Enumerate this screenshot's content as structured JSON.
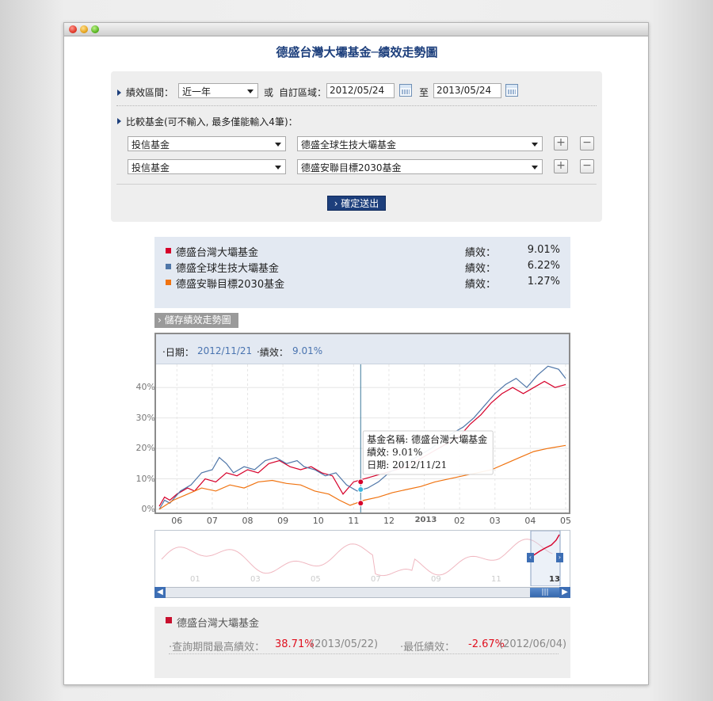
{
  "page_title": "德盛台灣大壩基金─績效走勢圖",
  "query": {
    "period_label": "績效區間：",
    "period_select": "近一年",
    "or_label": "或",
    "custom_label": "自訂區域：",
    "start_date": "2012/05/24",
    "to_label": "至",
    "end_date": "2013/05/24",
    "compare_label": "比較基金(可不輸入, 最多僅能輸入4筆)：",
    "compare_rows": [
      {
        "category": "投信基金",
        "fund": "德盛全球生技大壩基金"
      },
      {
        "category": "投信基金",
        "fund": "德盛安聯目標2030基金"
      }
    ],
    "plus": "+",
    "minus": "−",
    "submit": "› 確定送出"
  },
  "legend": [
    {
      "name": "德盛台灣大壩基金",
      "perf_label": "績效：",
      "perf": "9.01%",
      "color": "#d6002a"
    },
    {
      "name": "德盛全球生技大壩基金",
      "perf_label": "績效：",
      "perf": "6.22%",
      "color": "#4f76a8"
    },
    {
      "name": "德盛安聯目標2030基金",
      "perf_label": "績效：",
      "perf": "1.27%",
      "color": "#f07310"
    }
  ],
  "save_button": "› 儲存績效走勢圖",
  "chart_header": {
    "date_label": "‧日期：",
    "date_value": "2012/11/21",
    "perf_label": "‧績效：",
    "perf_value": "9.01%"
  },
  "tooltip": {
    "name_line": "基金名稱: 德盛台灣大壩基金",
    "perf_line": "績效: 9.01%",
    "date_line": "日期: 2012/11/21"
  },
  "chart_data": {
    "type": "line",
    "y_ticks": [
      "40%",
      "30%",
      "20%",
      "10%",
      "0%"
    ],
    "x_ticks": [
      "06",
      "07",
      "08",
      "09",
      "10",
      "11",
      "12",
      "2013",
      "02",
      "03",
      "04",
      "05"
    ],
    "ylim": [
      0,
      45
    ],
    "grid": true,
    "series": [
      {
        "name": "德盛台灣大壩基金",
        "color": "#d6002a",
        "points": [
          [
            0,
            1
          ],
          [
            0.15,
            4
          ],
          [
            0.3,
            3
          ],
          [
            0.5,
            5
          ],
          [
            0.8,
            7
          ],
          [
            1.0,
            6
          ],
          [
            1.3,
            10
          ],
          [
            1.6,
            9
          ],
          [
            1.9,
            12
          ],
          [
            2.2,
            11
          ],
          [
            2.5,
            13
          ],
          [
            2.8,
            12
          ],
          [
            3.1,
            15
          ],
          [
            3.4,
            16
          ],
          [
            3.7,
            14
          ],
          [
            4.0,
            13
          ],
          [
            4.3,
            14
          ],
          [
            4.6,
            12
          ],
          [
            4.9,
            11
          ],
          [
            5.2,
            5
          ],
          [
            5.5,
            9
          ],
          [
            5.8,
            10
          ],
          [
            6.1,
            11
          ],
          [
            6.4,
            12
          ],
          [
            6.7,
            13
          ],
          [
            7.0,
            14
          ],
          [
            7.3,
            16
          ],
          [
            7.6,
            18
          ],
          [
            7.9,
            20
          ],
          [
            8.2,
            22
          ],
          [
            8.5,
            24
          ],
          [
            8.8,
            28
          ],
          [
            9.1,
            31
          ],
          [
            9.4,
            35
          ],
          [
            9.7,
            38
          ],
          [
            10.0,
            40
          ],
          [
            10.3,
            38
          ],
          [
            10.6,
            40
          ],
          [
            10.9,
            42
          ],
          [
            11.2,
            40
          ],
          [
            11.5,
            41
          ]
        ]
      },
      {
        "name": "德盛全球生技大壩基金",
        "color": "#4f76a8",
        "points": [
          [
            0,
            0
          ],
          [
            0.15,
            3
          ],
          [
            0.3,
            2
          ],
          [
            0.6,
            6
          ],
          [
            0.9,
            8
          ],
          [
            1.2,
            12
          ],
          [
            1.5,
            13
          ],
          [
            1.7,
            17
          ],
          [
            1.9,
            15
          ],
          [
            2.1,
            12
          ],
          [
            2.4,
            14
          ],
          [
            2.7,
            13
          ],
          [
            3.0,
            16
          ],
          [
            3.3,
            17
          ],
          [
            3.6,
            15
          ],
          [
            3.9,
            16
          ],
          [
            4.1,
            14
          ],
          [
            4.4,
            13
          ],
          [
            4.7,
            11
          ],
          [
            5.0,
            12
          ],
          [
            5.3,
            8
          ],
          [
            5.6,
            6
          ],
          [
            5.9,
            7
          ],
          [
            6.2,
            9
          ],
          [
            6.5,
            12
          ],
          [
            6.8,
            14
          ],
          [
            7.1,
            16
          ],
          [
            7.4,
            18
          ],
          [
            7.7,
            20
          ],
          [
            8.0,
            23
          ],
          [
            8.3,
            25
          ],
          [
            8.6,
            27
          ],
          [
            8.9,
            30
          ],
          [
            9.2,
            34
          ],
          [
            9.5,
            38
          ],
          [
            9.8,
            41
          ],
          [
            10.1,
            43
          ],
          [
            10.4,
            40
          ],
          [
            10.7,
            44
          ],
          [
            11.0,
            47
          ],
          [
            11.3,
            46
          ],
          [
            11.5,
            43
          ]
        ]
      },
      {
        "name": "德盛安聯目標2030基金",
        "color": "#f07310",
        "points": [
          [
            0,
            0
          ],
          [
            0.4,
            3
          ],
          [
            0.8,
            5
          ],
          [
            1.2,
            7
          ],
          [
            1.6,
            6
          ],
          [
            2.0,
            8
          ],
          [
            2.4,
            7
          ],
          [
            2.8,
            9
          ],
          [
            3.2,
            9.5
          ],
          [
            3.6,
            8.5
          ],
          [
            4.0,
            8
          ],
          [
            4.4,
            6
          ],
          [
            4.8,
            5
          ],
          [
            5.1,
            3
          ],
          [
            5.4,
            1.3
          ],
          [
            5.8,
            3
          ],
          [
            6.2,
            4
          ],
          [
            6.6,
            5.5
          ],
          [
            7.0,
            6.5
          ],
          [
            7.4,
            7.5
          ],
          [
            7.8,
            9
          ],
          [
            8.2,
            10
          ],
          [
            8.6,
            11
          ],
          [
            9.0,
            12
          ],
          [
            9.4,
            13
          ],
          [
            9.8,
            15
          ],
          [
            10.2,
            17
          ],
          [
            10.6,
            19
          ],
          [
            11.0,
            20
          ],
          [
            11.5,
            21
          ]
        ]
      }
    ]
  },
  "navigator": {
    "x_labels": [
      "01",
      "03",
      "05",
      "07",
      "09",
      "11",
      "13"
    ]
  },
  "stats": {
    "fund_name": "德盛台灣大壩基金",
    "max_label": "‧查詢期間最高績效：",
    "max_value": "38.71%",
    "max_date": "(2013/05/22)",
    "min_label": "‧最低績效：",
    "min_value": "-2.67%",
    "min_date": "(2012/06/04)"
  }
}
